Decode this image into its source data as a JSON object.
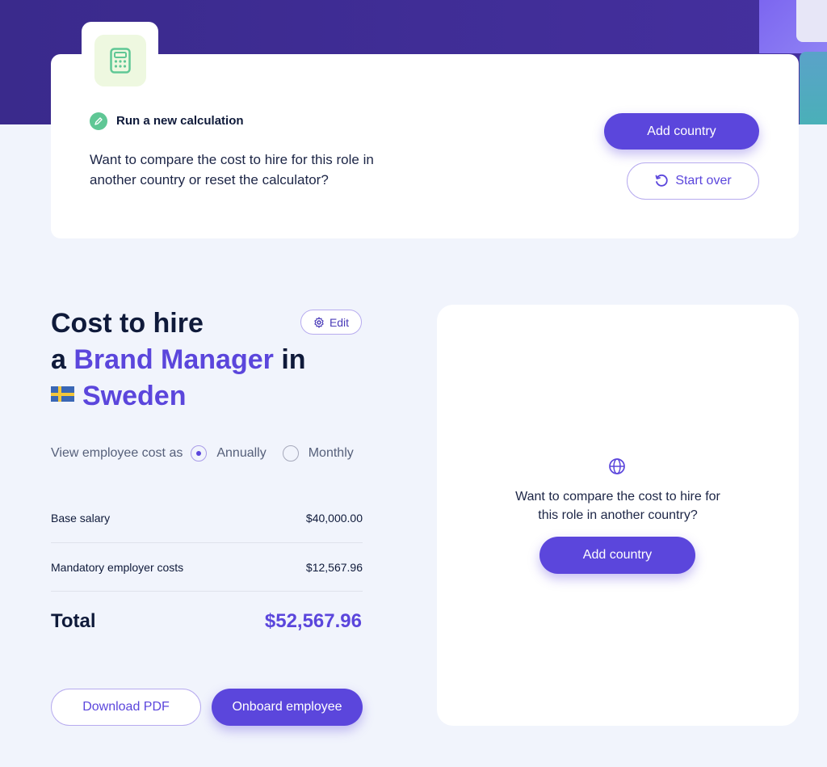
{
  "calc_card": {
    "heading": "Run a new calculation",
    "description": "Want to compare the cost to hire for this role in another country or reset the calculator?",
    "add_country_label": "Add country",
    "start_over_label": "Start over"
  },
  "cost": {
    "title_prefix": "Cost to hire",
    "article": "a",
    "role": "Brand Manager",
    "connector": "in",
    "country": "Sweden",
    "edit_label": "Edit",
    "view_label": "View employee cost as",
    "period_options": [
      "Annually",
      "Monthly"
    ],
    "selected_period": "Annually",
    "rows": [
      {
        "label": "Base salary",
        "value": "$40,000.00"
      },
      {
        "label": "Mandatory employer costs",
        "value": "$12,567.96"
      }
    ],
    "total_label": "Total",
    "total_value": "$52,567.96",
    "download_label": "Download PDF",
    "onboard_label": "Onboard employee"
  },
  "compare_card": {
    "text": "Want to compare the cost to hire for this role in another country?",
    "add_country_label": "Add country"
  },
  "colors": {
    "brand": "#5b46dc",
    "hero": "#3a2a8c",
    "background": "#f1f4fc"
  },
  "icons": {
    "calculator": "calculator-icon",
    "pencil": "pencil-icon",
    "refresh": "refresh-icon",
    "gear": "gear-icon",
    "globe": "globe-icon",
    "flag": "sweden-flag-icon"
  }
}
